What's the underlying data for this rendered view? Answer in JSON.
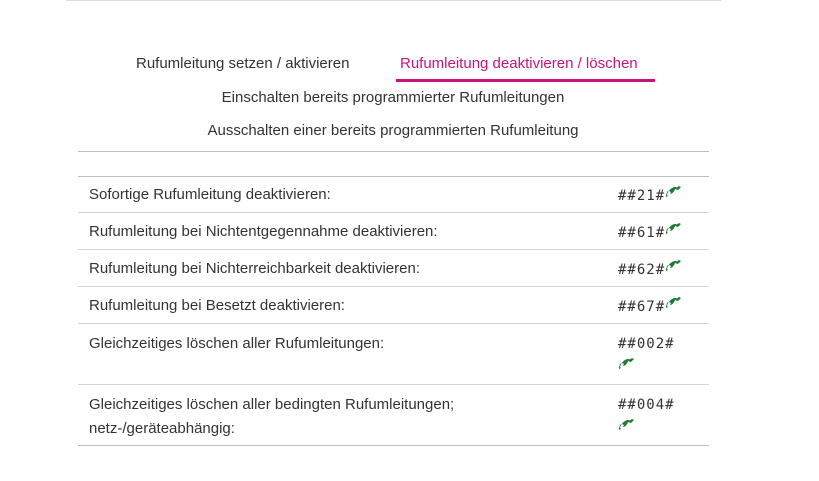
{
  "tabs": {
    "set": "Rufumleitung setzen / aktivieren",
    "delete": "Rufumleitung deaktivieren / löschen"
  },
  "subheadings": {
    "enable": "Einschalten bereits programmierter Rufumleitungen",
    "disable": "Ausschalten einer bereits programmierten Rufumleitung"
  },
  "rows": [
    {
      "label": "Sofortige Rufumleitung deaktivieren:",
      "code": "##21#"
    },
    {
      "label": "Rufumleitung bei Nichtentgegennahme deaktivieren:",
      "code": "##61#"
    },
    {
      "label": "Rufumleitung bei Nichterreichbarkeit deaktivieren:",
      "code": "##62#"
    },
    {
      "label": "Rufumleitung bei Besetzt deaktivieren:",
      "code": "##67#"
    },
    {
      "label": "Gleichzeitiges löschen aller Rufumleitungen:",
      "code": "##002#"
    },
    {
      "label_line1": "Gleichzeitiges löschen aller bedingten Rufumleitungen;",
      "label_line2": "netz-/geräteabhängig:",
      "code": "##004#"
    }
  ],
  "colors": {
    "accent": "#c4157f",
    "phone_icon": "#1f7a2e"
  },
  "icons": {
    "call": "phone-call-icon"
  }
}
